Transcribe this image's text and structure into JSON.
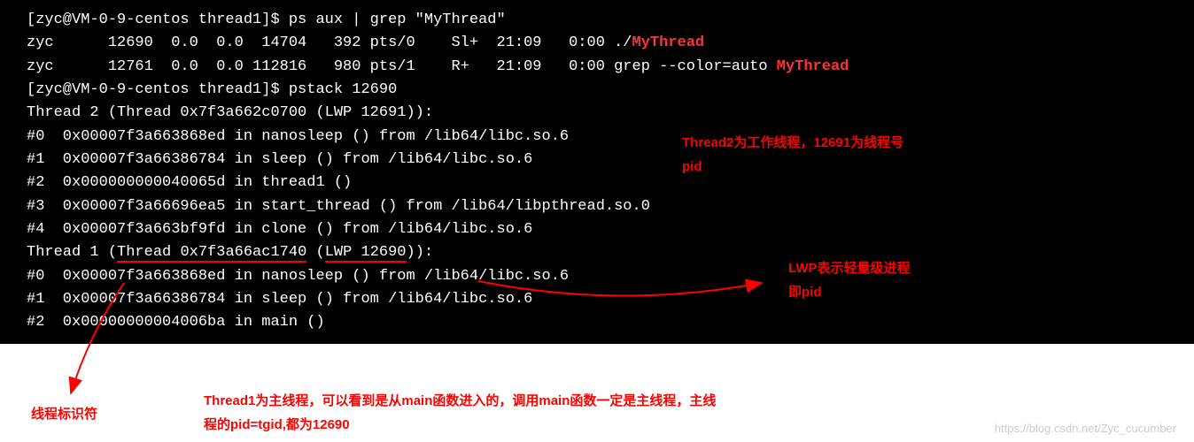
{
  "terminal": {
    "prompt1_user": "[zyc@VM-0-9-centos thread1]$ ",
    "cmd1": "ps aux | grep \"MyThread\"",
    "ps_line1_pre": "zyc      12690  0.0  0.0  14704   392 pts/0    Sl+  21:09   0:00 ./",
    "ps_line1_hl": "MyThread",
    "ps_line2_pre": "zyc      12761  0.0  0.0 112816   980 pts/1    R+   21:09   0:00 grep --color=auto ",
    "ps_line2_hl": "MyThread",
    "prompt2_user": "[zyc@VM-0-9-centos thread1]$ ",
    "cmd2": "pstack 12690",
    "t2_header": "Thread 2 (Thread 0x7f3a662c0700 (LWP 12691)):",
    "t2_f0": "#0  0x00007f3a663868ed in nanosleep () from /lib64/libc.so.6",
    "t2_f1": "#1  0x00007f3a66386784 in sleep () from /lib64/libc.so.6",
    "t2_f2": "#2  0x000000000040065d in thread1 ()",
    "t2_f3": "#3  0x00007f3a66696ea5 in start_thread () from /lib64/libpthread.so.0",
    "t2_f4": "#4  0x00007f3a663bf9fd in clone () from /lib64/libc.so.6",
    "t1_header_pre": "Thread 1 (",
    "t1_header_ul1": "Thread 0x7f3a66ac1740",
    "t1_header_mid": " (",
    "t1_header_ul2": "LWP 12690",
    "t1_header_post": ")):",
    "t1_f0": "#0  0x00007f3a663868ed in nanosleep () from /lib64/libc.so.6",
    "t1_f1": "#1  0x00007f3a66386784 in sleep () from /lib64/libc.so.6",
    "t1_f2": "#2  0x00000000004006ba in main ()"
  },
  "annotations": {
    "thread2_note_l1": "Thread2为工作线程，12691为线程号",
    "thread2_note_l2": "pid",
    "lwp_note_l1": "LWP表示轻量级进程",
    "lwp_note_l2": "即pid",
    "bottom_red_l1": "Thread1为主线程，可以看到是从main函数进入的，调用main函数一定是主线程，主线",
    "bottom_red_l2": "程的pid=tgid,都为12690",
    "thread_id_label": "线程标识符"
  },
  "watermark": "https://blog.csdn.net/Zyc_cucumber"
}
